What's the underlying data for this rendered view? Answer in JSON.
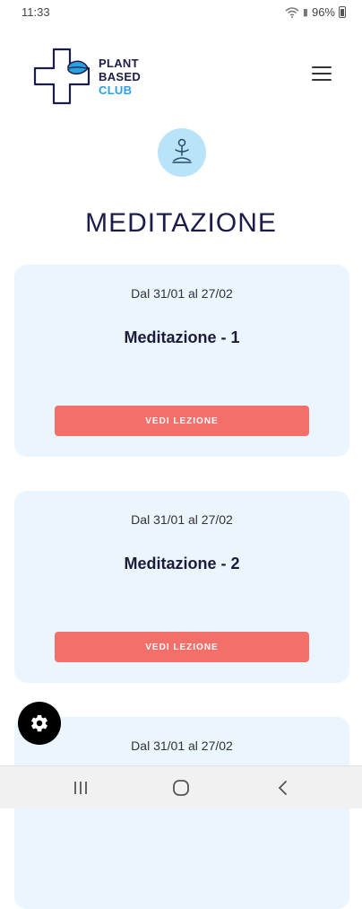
{
  "status_bar": {
    "time": "11:33",
    "battery": "96%"
  },
  "header": {
    "logo": {
      "line1": "PLANT",
      "line2": "BASED",
      "line3": "CLUB"
    },
    "menu_icon": "hamburger-icon"
  },
  "page": {
    "icon": "meditation-icon",
    "title": "MEDITAZIONE"
  },
  "lessons": [
    {
      "date_range": "Dal 31/01 al 27/02",
      "title": "Meditazione - 1",
      "button_label": "VEDI LEZIONE"
    },
    {
      "date_range": "Dal 31/01 al 27/02",
      "title": "Meditazione - 2",
      "button_label": "VEDI LEZIONE"
    },
    {
      "date_range": "Dal 31/01 al 27/02"
    }
  ],
  "fab": {
    "icon": "gear-icon"
  },
  "nav_bar": {
    "icons": [
      "recent-apps-icon",
      "home-icon",
      "back-icon"
    ]
  },
  "colors": {
    "primary_dark": "#1c1c4a",
    "accent_blue": "#2aa0e0",
    "card_bg": "#eaf5fe",
    "button_coral": "#f3706a"
  }
}
